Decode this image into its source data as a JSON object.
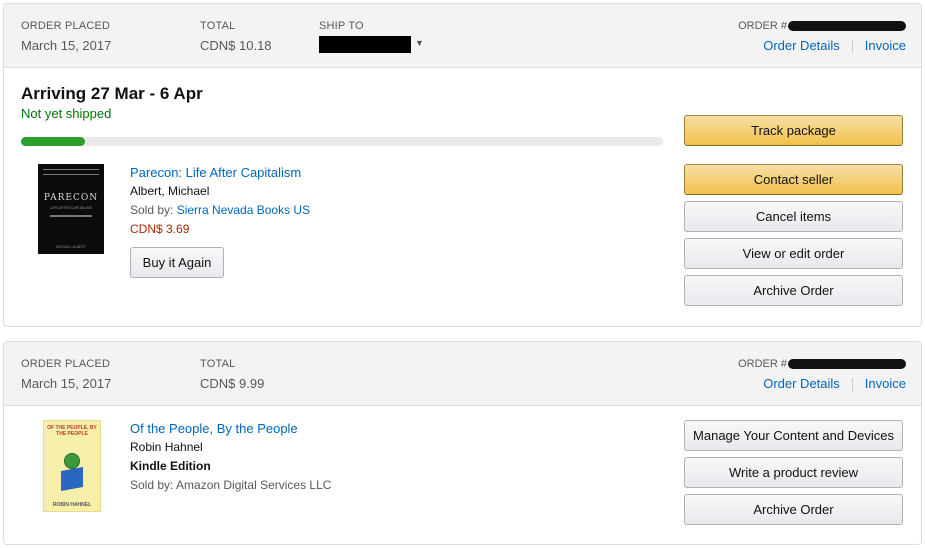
{
  "orders": [
    {
      "placed_label": "ORDER PLACED",
      "placed_date": "March 15, 2017",
      "total_label": "TOTAL",
      "total_value": "CDN$ 10.18",
      "ship_label": "SHIP TO",
      "order_label": "ORDER #",
      "details_link": "Order Details",
      "invoice_link": "Invoice",
      "arriving": "Arriving 27 Mar - 6 Apr",
      "status": "Not yet shipped",
      "progress": 0.1,
      "item": {
        "cover_title": "PARECON",
        "cover_subtitle": "LIFE AFTER CAPITALISM",
        "cover_author": "MICHAEL ALBERT",
        "title": "Parecon: Life After Capitalism",
        "author": "Albert, Michael",
        "sold_by_label": "Sold by:",
        "seller": "Sierra Nevada Books US",
        "price": "CDN$ 3.69",
        "buy_again": "Buy it Again"
      },
      "actions": [
        "Track package",
        "Contact seller",
        "Cancel items",
        "View or edit order",
        "Archive Order"
      ]
    },
    {
      "placed_label": "ORDER PLACED",
      "placed_date": "March 15, 2017",
      "total_label": "TOTAL",
      "total_value": "CDN$ 9.99",
      "order_label": "ORDER #",
      "details_link": "Order Details",
      "invoice_link": "Invoice",
      "item": {
        "cover_title": "OF THE PEOPLE, BY THE PEOPLE",
        "cover_author": "ROBIN HAHNEL",
        "title": "Of the People, By the People",
        "author": "Robin Hahnel",
        "format": "Kindle Edition",
        "sold_by": "Sold by: Amazon Digital Services LLC"
      },
      "actions": [
        "Manage Your Content and Devices",
        "Write a product review",
        "Archive Order"
      ]
    }
  ],
  "colors": {
    "link": "#0066c0",
    "shipped_status": "#007600",
    "price": "#b12704",
    "progress": "#2b9e2b",
    "primary_button": "#f0c14b"
  }
}
